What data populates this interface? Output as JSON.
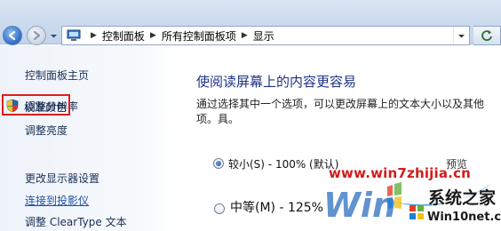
{
  "address_bar": {
    "crumbs": [
      "控制面板",
      "所有控制面板项",
      "显示"
    ]
  },
  "sidebar": {
    "home": "控制面板主页",
    "items": [
      {
        "label": "调整分辨率"
      },
      {
        "label": "调整亮度"
      },
      {
        "label": "校准颜色",
        "highlighted": true
      },
      {
        "label": "更改显示器设置"
      },
      {
        "label": "连接到投影仪"
      },
      {
        "label": "调整 ClearType 文本"
      }
    ]
  },
  "main": {
    "title": "使阅读屏幕上的内容更容易",
    "description": "通过选择其中一个选项，可以更改屏幕上的文本大小以及其他项。具。",
    "preview_label": "预览",
    "options": [
      {
        "label": "较小(S) - 100% (默认)",
        "selected": true
      },
      {
        "label": "中等(M) - 125%",
        "selected": false
      }
    ]
  },
  "watermark": {
    "url": "www.win7zhijia.cn",
    "brand": "系统之家",
    "site": "Win10net.com"
  },
  "colors": {
    "highlight_box": "#e21d1d",
    "title_blue": "#1e3287",
    "link_blue": "#1f4fa8",
    "watermark_red": "#d21b1b"
  }
}
